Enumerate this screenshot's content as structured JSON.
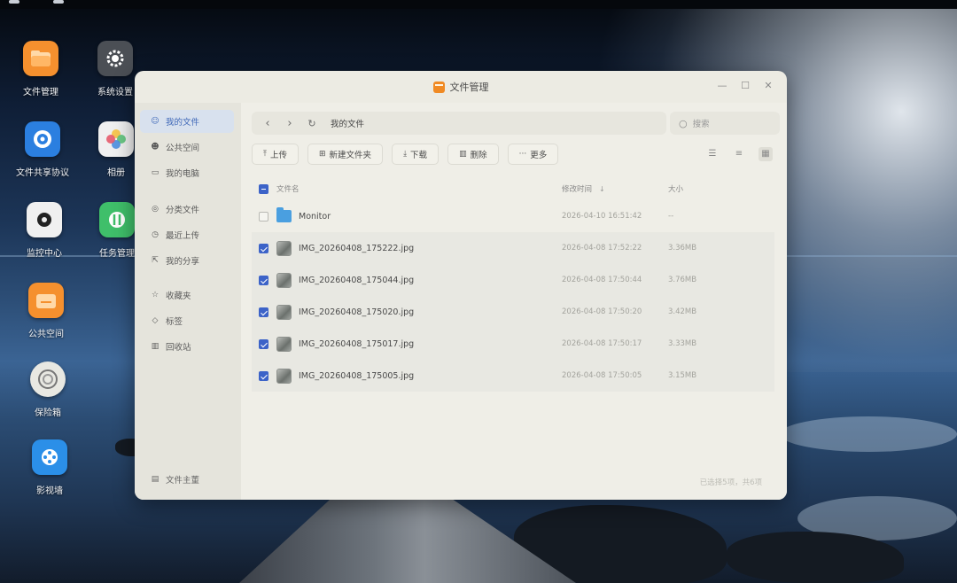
{
  "desktop": {
    "icons": [
      {
        "label": "文件管理",
        "color": "#f5902e",
        "icon": "file-manager-icon"
      },
      {
        "label": "系统设置",
        "color": "#4b4f55",
        "icon": "gear-icon"
      },
      {
        "label": "文件共享协议",
        "color": "#2b7fe0",
        "icon": "share-protocol-icon"
      },
      {
        "label": "相册",
        "color": "#f0f0f0",
        "icon": "photos-icon"
      },
      {
        "label": "监控中心",
        "color": "#f0f0f0",
        "icon": "camera-icon"
      },
      {
        "label": "任务管理",
        "color": "#3fbf6a",
        "icon": "task-manager-icon"
      },
      {
        "label": "公共空间",
        "color": "#f5902e",
        "icon": "public-space-icon"
      },
      {
        "label": "保险箱",
        "color": "#e8e8e2",
        "icon": "safe-icon"
      },
      {
        "label": "影视墙",
        "color": "#2b8fe8",
        "icon": "film-reel-icon"
      }
    ]
  },
  "window": {
    "title": "文件管理",
    "sidebar": {
      "items": [
        {
          "label": "我的文件",
          "icon": "user-icon",
          "active": true
        },
        {
          "label": "公共空间",
          "icon": "group-icon",
          "active": false
        },
        {
          "label": "我的电脑",
          "icon": "monitor-icon",
          "active": false
        },
        {
          "label": "分类文件",
          "icon": "category-icon",
          "active": false
        },
        {
          "label": "最近上传",
          "icon": "clock-icon",
          "active": false
        },
        {
          "label": "我的分享",
          "icon": "share-icon",
          "active": false
        },
        {
          "label": "收藏夹",
          "icon": "star-icon",
          "active": false
        },
        {
          "label": "标签",
          "icon": "tag-icon",
          "active": false
        },
        {
          "label": "回收站",
          "icon": "trash-icon",
          "active": false
        }
      ],
      "footer": "文件主董"
    },
    "path": "我的文件",
    "search_placeholder": "搜索",
    "toolbar": {
      "upload": "上传",
      "new_folder": "新建文件夹",
      "download": "下载",
      "delete": "删除",
      "more": "更多"
    },
    "table": {
      "headers": {
        "name": "文件名",
        "modified": "修改时间",
        "size": "大小"
      },
      "rows": [
        {
          "name": "Monitor",
          "type": "folder",
          "modified": "2026-04-10 16:51:42",
          "size": "--",
          "checked": false
        },
        {
          "name": "IMG_20260408_175222.jpg",
          "type": "image",
          "modified": "2026-04-08 17:52:22",
          "size": "3.36MB",
          "checked": true
        },
        {
          "name": "IMG_20260408_175044.jpg",
          "type": "image",
          "modified": "2026-04-08 17:50:44",
          "size": "3.76MB",
          "checked": true
        },
        {
          "name": "IMG_20260408_175020.jpg",
          "type": "image",
          "modified": "2026-04-08 17:50:20",
          "size": "3.42MB",
          "checked": true
        },
        {
          "name": "IMG_20260408_175017.jpg",
          "type": "image",
          "modified": "2026-04-08 17:50:17",
          "size": "3.33MB",
          "checked": true
        },
        {
          "name": "IMG_20260408_175005.jpg",
          "type": "image",
          "modified": "2026-04-08 17:50:05",
          "size": "3.15MB",
          "checked": true
        }
      ]
    },
    "status": "已选择5项，共6项"
  }
}
